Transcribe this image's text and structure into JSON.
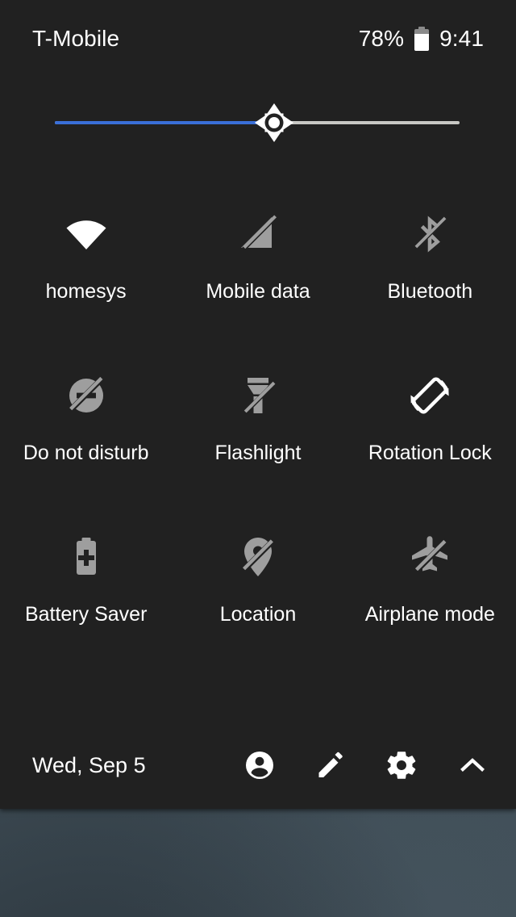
{
  "status_bar": {
    "carrier": "T-Mobile",
    "battery_percent": "78%",
    "battery_level": 78,
    "battery_icon": "battery-icon",
    "clock": "9:41"
  },
  "brightness": {
    "name": "brightness-slider",
    "value_percent": 54,
    "thumb_icon": "brightness-sun-icon",
    "fill_color": "#3a6fd8",
    "track_color": "#c8c8c4"
  },
  "tiles": [
    {
      "id": "wifi",
      "label": "homesys",
      "icon": "wifi-icon",
      "enabled": true
    },
    {
      "id": "mobile-data",
      "label": "Mobile data",
      "icon": "mobile-data-off-icon",
      "enabled": false
    },
    {
      "id": "bluetooth",
      "label": "Bluetooth",
      "icon": "bluetooth-off-icon",
      "enabled": false
    },
    {
      "id": "do-not-disturb",
      "label": "Do not disturb",
      "icon": "do-not-disturb-off-icon",
      "enabled": false
    },
    {
      "id": "flashlight",
      "label": "Flashlight",
      "icon": "flashlight-off-icon",
      "enabled": false
    },
    {
      "id": "rotation-lock",
      "label": "Rotation Lock",
      "icon": "screen-rotation-icon",
      "enabled": true
    },
    {
      "id": "battery-saver",
      "label": "Battery Saver",
      "icon": "battery-saver-icon",
      "enabled": false
    },
    {
      "id": "location",
      "label": "Location",
      "icon": "location-off-icon",
      "enabled": false
    },
    {
      "id": "airplane-mode",
      "label": "Airplane mode",
      "icon": "airplane-off-icon",
      "enabled": false
    }
  ],
  "footer": {
    "date": "Wed, Sep 5",
    "actions": [
      {
        "id": "user",
        "icon": "user-account-icon"
      },
      {
        "id": "edit",
        "icon": "pencil-edit-icon"
      },
      {
        "id": "settings",
        "icon": "gear-icon"
      },
      {
        "id": "collapse",
        "icon": "chevron-up-icon"
      }
    ]
  },
  "colors": {
    "panel_background": "#212121",
    "icon_enabled": "#ffffff",
    "icon_disabled": "#9e9e9e",
    "text": "#ffffff",
    "accent": "#3a6fd8",
    "wallpaper": "#3e4c58"
  }
}
